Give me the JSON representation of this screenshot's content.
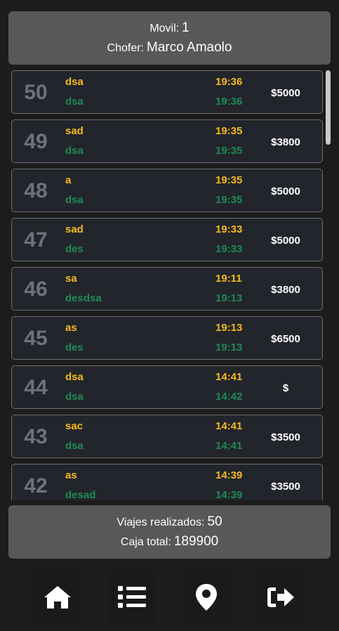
{
  "header": {
    "movil_label": "Movil:",
    "movil_value": "1",
    "chofer_label": "Chofer:",
    "chofer_value": "Marco Amaolo"
  },
  "trips": [
    {
      "number": "50",
      "origin": "dsa",
      "destination": "dsa",
      "start_time": "19:36",
      "end_time": "19:36",
      "price": "$5000"
    },
    {
      "number": "49",
      "origin": "sad",
      "destination": "dsa",
      "start_time": "19:35",
      "end_time": "19:35",
      "price": "$3800"
    },
    {
      "number": "48",
      "origin": "a",
      "destination": "dsa",
      "start_time": "19:35",
      "end_time": "19:35",
      "price": "$5000"
    },
    {
      "number": "47",
      "origin": "sad",
      "destination": "des",
      "start_time": "19:33",
      "end_time": "19:33",
      "price": "$5000"
    },
    {
      "number": "46",
      "origin": "sa",
      "destination": "desdsa",
      "start_time": "19:11",
      "end_time": "19:13",
      "price": "$3800"
    },
    {
      "number": "45",
      "origin": "as",
      "destination": "des",
      "start_time": "19:13",
      "end_time": "19:13",
      "price": "$6500"
    },
    {
      "number": "44",
      "origin": "dsa",
      "destination": "dsa",
      "start_time": "14:41",
      "end_time": "14:42",
      "price": "$"
    },
    {
      "number": "43",
      "origin": "sac",
      "destination": "dsa",
      "start_time": "14:41",
      "end_time": "14:41",
      "price": "$3500"
    },
    {
      "number": "42",
      "origin": "as",
      "destination": "desad",
      "start_time": "14:39",
      "end_time": "14:39",
      "price": "$3500"
    }
  ],
  "footer": {
    "viajes_label": "Viajes realizados:",
    "viajes_value": "50",
    "caja_label": "Caja total:",
    "caja_value": "189900"
  },
  "nav": [
    "home-icon",
    "list-icon",
    "map-pin-icon",
    "logout-icon"
  ],
  "colors": {
    "background": "#1c1c1c",
    "panel": "#585858",
    "card": "#22252b",
    "origin": "#f5b921",
    "destination": "#1f8a56",
    "trip_number": "#6c737c"
  }
}
